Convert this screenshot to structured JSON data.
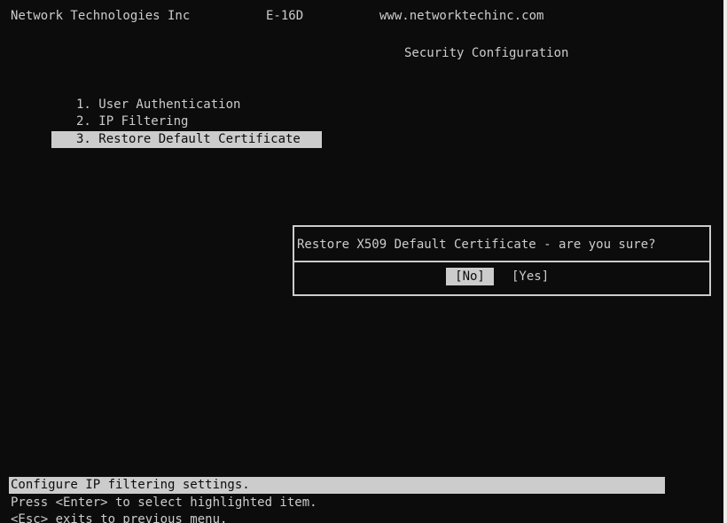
{
  "header": {
    "company": "Network Technologies Inc",
    "model": "E-16D",
    "url": "www.networktechinc.com"
  },
  "screen_title": "Security Configuration",
  "menu": {
    "items": [
      {
        "label": "1. User Authentication"
      },
      {
        "label": "2. IP Filtering"
      },
      {
        "label": "3. Restore Default Certificate"
      }
    ],
    "selected_index": 2
  },
  "dialog": {
    "message": "Restore X509 Default Certificate - are you sure?",
    "no_label": "[No]",
    "yes_label": "[Yes]",
    "selected": "No"
  },
  "status_bar": {
    "text": "Configure IP filtering settings."
  },
  "help": {
    "line1": "Press <Enter> to select highlighted item.",
    "line2": "<Esc> exits to previous menu."
  },
  "colors": {
    "background": "#0c0c0c",
    "foreground": "#cccccc",
    "highlight_background": "#cccccc",
    "highlight_foreground": "#0c0c0c"
  }
}
